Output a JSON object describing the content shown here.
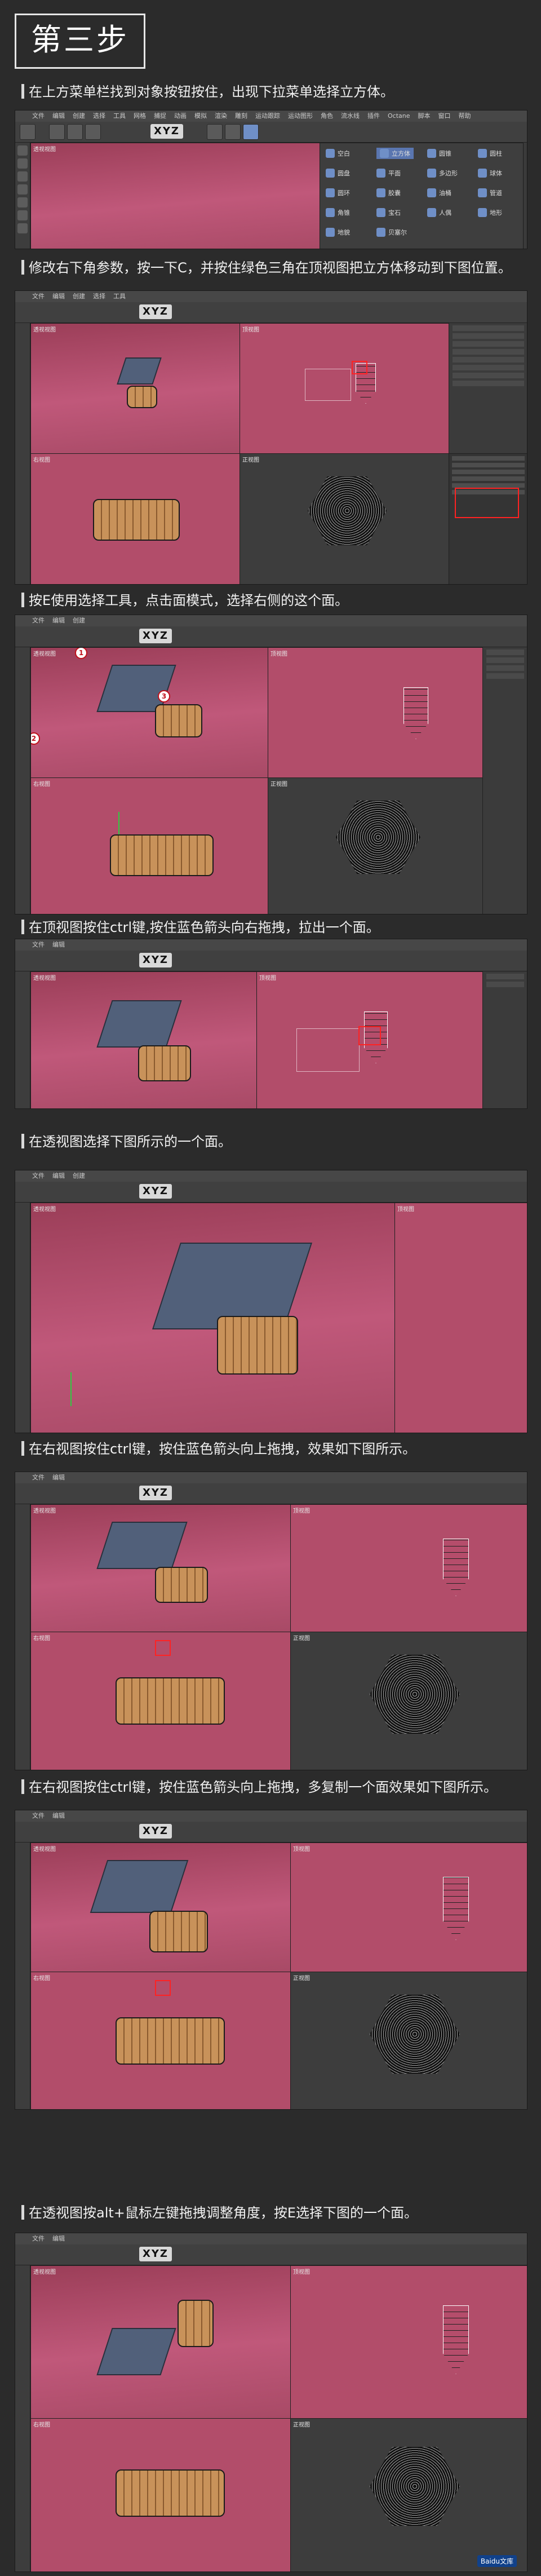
{
  "step_title": "第三步",
  "menu": [
    "文件",
    "编辑",
    "创建",
    "选择",
    "工具",
    "网格",
    "捕捉",
    "动画",
    "模拟",
    "渲染",
    "雕刻",
    "运动跟踪",
    "运动图形",
    "角色",
    "流水线",
    "插件",
    "Octane",
    "脚本",
    "窗口",
    "帮助"
  ],
  "viewports": {
    "perspective": "透视视图",
    "top": "顶视图",
    "right": "右视图",
    "front": "正视图"
  },
  "axis_buttons": "XYZ",
  "dropdown_menu": [
    "空白",
    "立方体",
    "圆锥",
    "圆柱",
    "圆盘",
    "平面",
    "多边形",
    "球体",
    "圆环",
    "胶囊",
    "油桶",
    "管道",
    "角锥",
    "宝石",
    "人偶",
    "地形",
    "地貌",
    "贝塞尔"
  ],
  "dropdown_selected": "立方体",
  "markers": [
    "1",
    "2",
    "3"
  ],
  "steps": [
    "在上方菜单栏找到对象按钮按住，出现下拉菜单选择立方体。",
    "修改右下角参数，按一下C，并按住绿色三角在顶视图把立方体移动到下图位置。",
    "按E使用选择工具，点击面模式，选择右侧的这个面。",
    "在顶视图按住ctrl键,按住蓝色箭头向右拖拽，拉出一个面。",
    "在透视图选择下图所示的一个面。",
    "在右视图按住ctrl键，按住蓝色箭头向上拖拽，效果如下图所示。",
    "在右视图按住ctrl键，按住蓝色箭头向上拖拽，多复制一个面效果如下图所示。",
    "在透视图按alt+鼠标左键拖拽调整角度，按E选择下图的一个面。"
  ],
  "watermark": "Baidu文库"
}
